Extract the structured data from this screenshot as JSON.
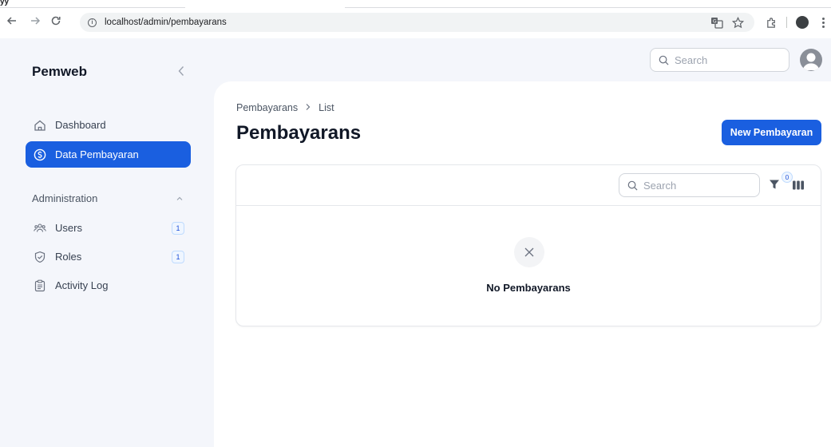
{
  "browser": {
    "url": "localhost/admin/pembayarans",
    "tab_stub": "yy"
  },
  "sidebar": {
    "brand": "Pemweb",
    "items": [
      {
        "label": "Dashboard",
        "icon": "home-icon"
      },
      {
        "label": "Data Pembayaran",
        "icon": "dollar-circle-icon",
        "active": true
      }
    ],
    "group": {
      "label": "Administration",
      "items": [
        {
          "label": "Users",
          "icon": "users-icon",
          "badge": "1"
        },
        {
          "label": "Roles",
          "icon": "shield-check-icon",
          "badge": "1"
        },
        {
          "label": "Activity Log",
          "icon": "clipboard-icon"
        }
      ]
    }
  },
  "topbar": {
    "search_placeholder": "Search"
  },
  "main": {
    "breadcrumb": [
      "Pembayarans",
      "List"
    ],
    "title": "Pembayarans",
    "new_button": "New Pembayaran",
    "table": {
      "search_placeholder": "Search",
      "filter_count": "0",
      "empty_text": "No Pembayarans"
    }
  },
  "colors": {
    "primary": "#1a5fe0",
    "app_background": "#f4f6fb"
  }
}
